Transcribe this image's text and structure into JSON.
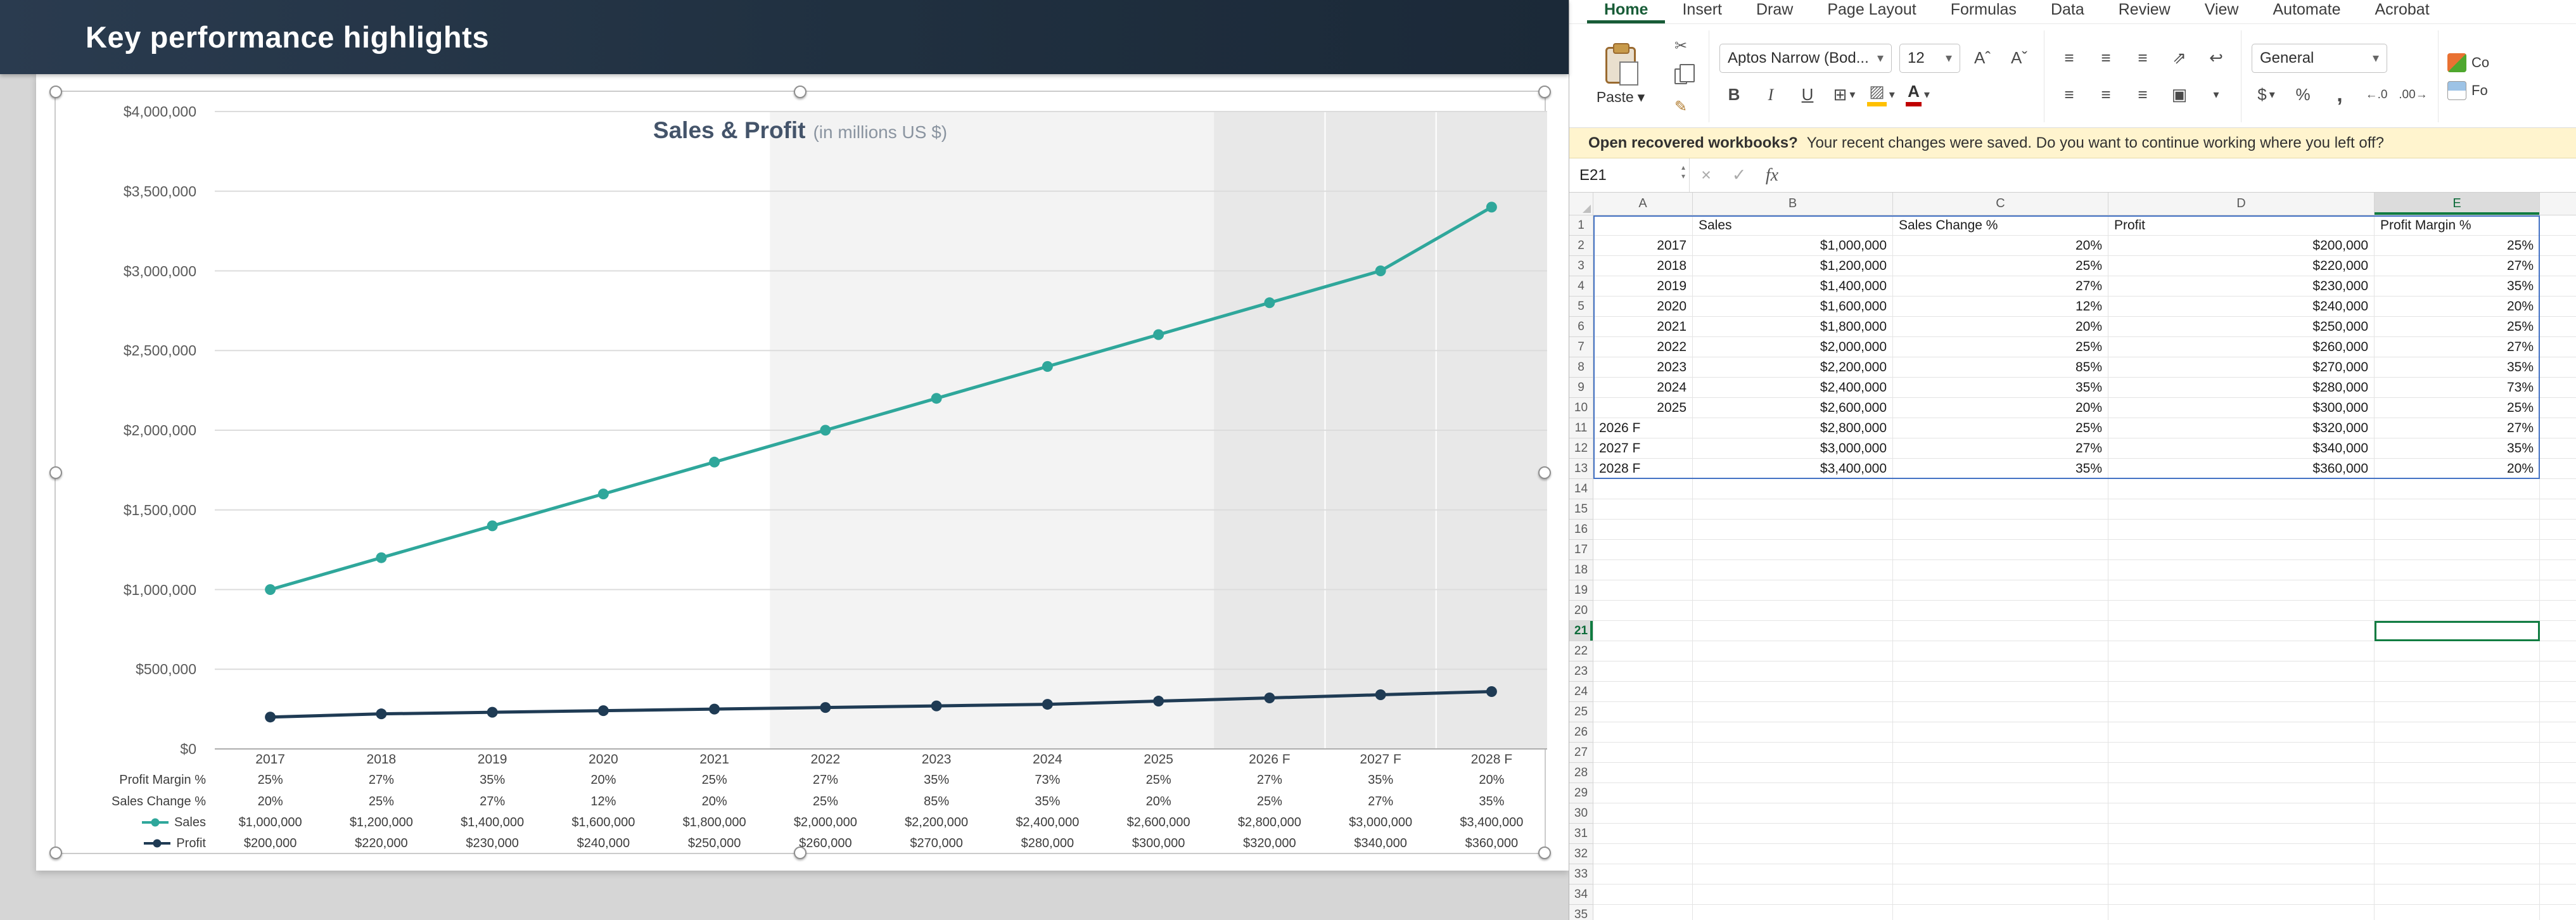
{
  "slide": {
    "title": "Key performance highlights"
  },
  "chart_data": {
    "type": "line",
    "title": "Sales & Profit",
    "subtitle": "(in millions US $)",
    "categories": [
      "2017",
      "2018",
      "2019",
      "2020",
      "2021",
      "2022",
      "2023",
      "2024",
      "2025",
      "2026 F",
      "2027 F",
      "2028 F"
    ],
    "series": [
      {
        "name": "Sales",
        "color": "#2FA79B",
        "values": [
          1000000,
          1200000,
          1400000,
          1600000,
          1800000,
          2000000,
          2200000,
          2400000,
          2600000,
          2800000,
          3000000,
          3400000
        ]
      },
      {
        "name": "Profit",
        "color": "#1F3B54",
        "values": [
          200000,
          220000,
          230000,
          240000,
          250000,
          260000,
          270000,
          280000,
          300000,
          320000,
          340000,
          360000
        ]
      }
    ],
    "ylim": [
      0,
      4000000
    ],
    "y_tick_step": 500000,
    "y_tick_labels": [
      "$0",
      "$500,000",
      "$1,000,000",
      "$1,500,000",
      "$2,000,000",
      "$2,500,000",
      "$3,000,000",
      "$3,500,000",
      "$4,000,000"
    ],
    "grid": true,
    "legend_position": "table-left",
    "shaded_region_start_index": 5,
    "forecast_band_start_index": 9,
    "table_rows": [
      {
        "label": "Profit Margin %",
        "marker_color": null,
        "values": [
          "25%",
          "27%",
          "35%",
          "20%",
          "25%",
          "27%",
          "35%",
          "73%",
          "25%",
          "27%",
          "35%",
          "20%"
        ]
      },
      {
        "label": "Sales Change %",
        "marker_color": null,
        "values": [
          "20%",
          "25%",
          "27%",
          "12%",
          "20%",
          "25%",
          "85%",
          "35%",
          "20%",
          "25%",
          "27%",
          "35%"
        ]
      },
      {
        "label": "Sales",
        "marker_color": "#2FA79B",
        "values": [
          "$1,000,000",
          "$1,200,000",
          "$1,400,000",
          "$1,600,000",
          "$1,800,000",
          "$2,000,000",
          "$2,200,000",
          "$2,400,000",
          "$2,600,000",
          "$2,800,000",
          "$3,000,000",
          "$3,400,000"
        ]
      },
      {
        "label": "Profit",
        "marker_color": "#1F3B54",
        "values": [
          "$200,000",
          "$220,000",
          "$230,000",
          "$240,000",
          "$250,000",
          "$260,000",
          "$270,000",
          "$280,000",
          "$300,000",
          "$320,000",
          "$340,000",
          "$360,000"
        ]
      }
    ]
  },
  "excel": {
    "tabs": [
      {
        "label": "Home",
        "active": true
      },
      {
        "label": "Insert"
      },
      {
        "label": "Draw"
      },
      {
        "label": "Page Layout"
      },
      {
        "label": "Formulas"
      },
      {
        "label": "Data"
      },
      {
        "label": "Review"
      },
      {
        "label": "View"
      },
      {
        "label": "Automate"
      },
      {
        "label": "Acrobat"
      }
    ],
    "ribbon": {
      "paste_label": "Paste",
      "font_name": "Aptos Narrow (Bod...",
      "font_size": "12",
      "bold": "B",
      "italic": "I",
      "underline": "U",
      "number_format": "General",
      "currency": "$",
      "percent": "%",
      "comma": ",",
      "conditional_truncated": "Co",
      "format_table_truncated": "Fo"
    },
    "recovery_bar": {
      "title": "Open recovered workbooks?",
      "message": "Your recent changes were saved. Do you want to continue working where you left off?"
    },
    "name_box": "E21",
    "fx_label": "fx",
    "column_headers": [
      "A",
      "B",
      "C",
      "D",
      "E"
    ],
    "rows": [
      [
        "",
        "Sales",
        "Sales Change %",
        "Profit",
        "Profit Margin %"
      ],
      [
        "2017",
        "$1,000,000",
        "20%",
        "$200,000",
        "25%"
      ],
      [
        "2018",
        "$1,200,000",
        "25%",
        "$220,000",
        "27%"
      ],
      [
        "2019",
        "$1,400,000",
        "27%",
        "$230,000",
        "35%"
      ],
      [
        "2020",
        "$1,600,000",
        "12%",
        "$240,000",
        "20%"
      ],
      [
        "2021",
        "$1,800,000",
        "20%",
        "$250,000",
        "25%"
      ],
      [
        "2022",
        "$2,000,000",
        "25%",
        "$260,000",
        "27%"
      ],
      [
        "2023",
        "$2,200,000",
        "85%",
        "$270,000",
        "35%"
      ],
      [
        "2024",
        "$2,400,000",
        "35%",
        "$280,000",
        "73%"
      ],
      [
        "2025",
        "$2,600,000",
        "20%",
        "$300,000",
        "25%"
      ],
      [
        "2026 F",
        "$2,800,000",
        "25%",
        "$320,000",
        "27%"
      ],
      [
        "2027 F",
        "$3,000,000",
        "27%",
        "$340,000",
        "35%"
      ],
      [
        "2028 F",
        "$3,400,000",
        "35%",
        "$360,000",
        "20%"
      ]
    ],
    "selected_cell": {
      "ref": "E21",
      "row": 21,
      "col": "E"
    },
    "data_range": {
      "rows": 13,
      "cols": 5
    },
    "accent_color": "#107C41",
    "range_border_color": "#4472C4"
  }
}
